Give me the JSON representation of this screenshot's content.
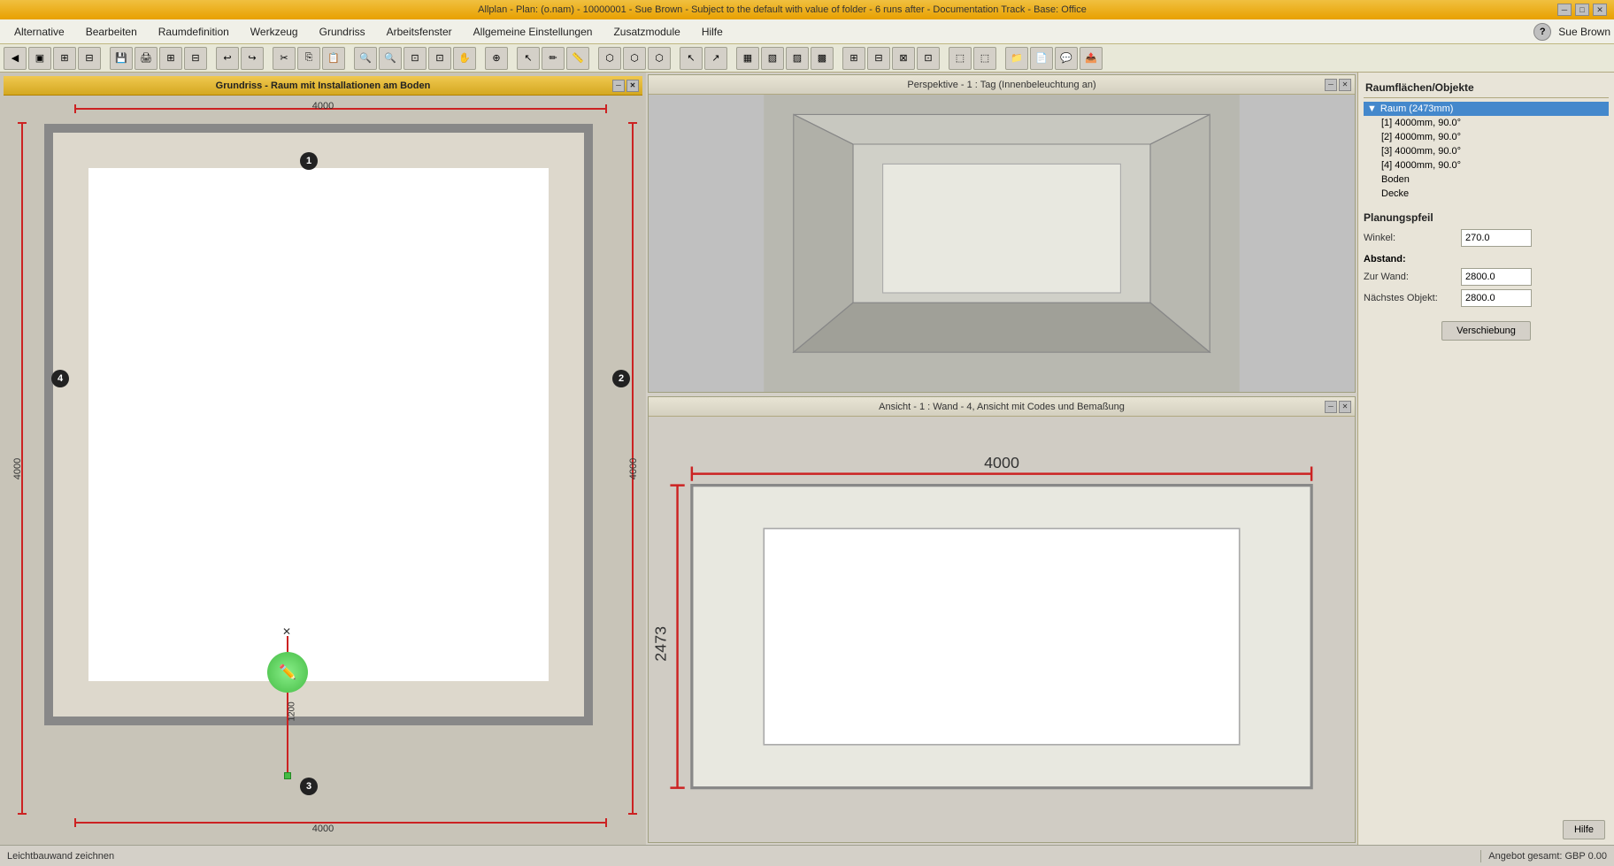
{
  "titlebar": {
    "title": "Allplan - Plan: (o.nam) - 10000001 - Sue Brown - Subject to the default with value of folder - 6 runs after - Documentation Track - Base: Office",
    "win_minimize": "─",
    "win_maximize": "□",
    "win_close": "✕"
  },
  "menubar": {
    "items": [
      {
        "id": "alternative",
        "label": "Alternative"
      },
      {
        "id": "bearbeiten",
        "label": "Bearbeiten"
      },
      {
        "id": "raumdefinition",
        "label": "Raumdefinition"
      },
      {
        "id": "werkzeug",
        "label": "Werkzeug"
      },
      {
        "id": "grundriss",
        "label": "Grundriss"
      },
      {
        "id": "arbeitsfenster",
        "label": "Arbeitsfenster"
      },
      {
        "id": "allgemeine-einstellungen",
        "label": "Allgemeine Einstellungen"
      },
      {
        "id": "zusatzmodule",
        "label": "Zusatzmodule"
      },
      {
        "id": "hilfe",
        "label": "Hilfe"
      }
    ],
    "user": "Sue Brown",
    "help_icon": "?"
  },
  "floorplan_window": {
    "title": "Grundriss - Raum mit Installationen am Boden",
    "dimension_top": "4000",
    "dimension_bottom": "4000",
    "dimension_left": "4000",
    "dimension_right": "4000",
    "wall_1": "1",
    "wall_2": "2",
    "wall_3": "3",
    "wall_4": "4",
    "cursor_dim": "1200"
  },
  "perspective_window": {
    "title": "Perspektive - 1 : Tag (Innenbeleuchtung an)"
  },
  "wall_view_window": {
    "title": "Ansicht - 1 : Wand - 4, Ansicht mit Codes und Bemaßung",
    "dimension_top": "4000",
    "dimension_left": "2473"
  },
  "right_sidebar": {
    "section_title": "Raumflächen/Objekte",
    "tree": [
      {
        "label": "Raum (2473mm)",
        "indent": 0,
        "selected": true,
        "has_arrow": true
      },
      {
        "label": "[1]  4000mm, 90.0°",
        "indent": 1,
        "selected": false
      },
      {
        "label": "[2]  4000mm, 90.0°",
        "indent": 1,
        "selected": false
      },
      {
        "label": "[3]  4000mm, 90.0°",
        "indent": 1,
        "selected": false
      },
      {
        "label": "[4]  4000mm, 90.0°",
        "indent": 1,
        "selected": false
      },
      {
        "label": "Boden",
        "indent": 1,
        "selected": false
      },
      {
        "label": "Decke",
        "indent": 1,
        "selected": false
      }
    ],
    "planning_section": "Planungspfeil",
    "winkel_label": "Winkel:",
    "winkel_value": "270.0",
    "abstand_label": "Abstand:",
    "zur_wand_label": "Zur Wand:",
    "zur_wand_value": "2800.0",
    "naechstes_obj_label": "Nächstes Objekt:",
    "naechstes_obj_value": "2800.0",
    "verschiebung_btn": "Verschiebung",
    "hilfe_btn": "Hilfe"
  },
  "statusbar": {
    "left": "Leichtbauwand zeichnen",
    "right": "Angebot gesamt: GBP 0.00"
  }
}
